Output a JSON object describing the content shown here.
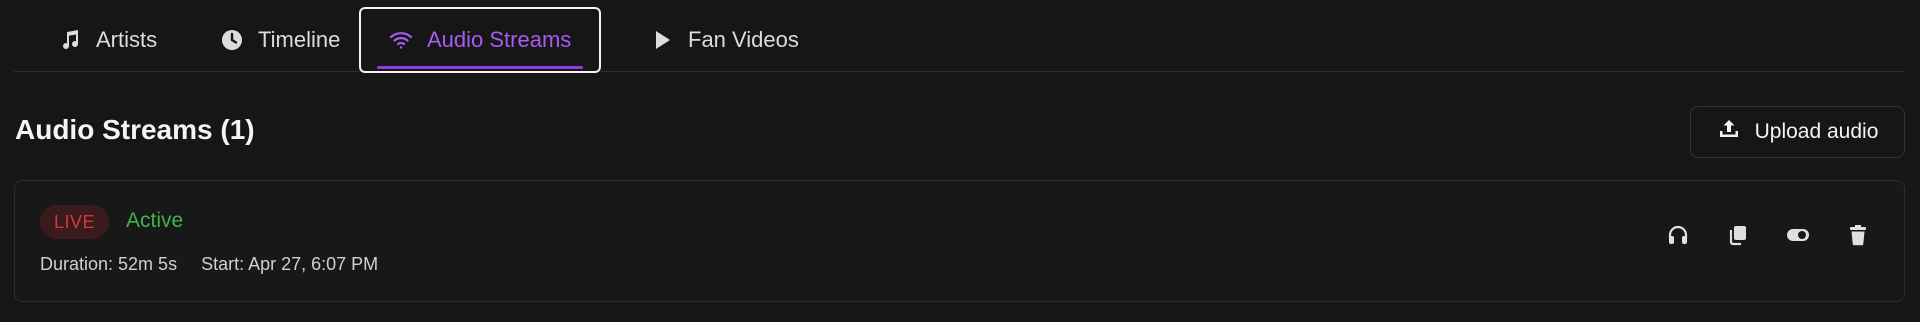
{
  "tabs": [
    {
      "label": "Artists",
      "icon": "music-note-icon",
      "active": false
    },
    {
      "label": "Timeline",
      "icon": "clock-icon",
      "active": false
    },
    {
      "label": "Audio Streams",
      "icon": "wifi-icon",
      "active": true
    },
    {
      "label": "Fan Videos",
      "icon": "play-icon",
      "active": false
    }
  ],
  "header": {
    "title": "Audio Streams (1)",
    "upload_label": "Upload audio",
    "upload_icon": "upload-icon"
  },
  "stream": {
    "badge": "LIVE",
    "status": "Active",
    "duration": "Duration: 52m 5s",
    "start": "Start: Apr 27, 6:07 PM",
    "actions": [
      "headphones-icon",
      "copy-icon",
      "toggle-icon",
      "trash-icon"
    ]
  },
  "colors": {
    "background": "#161616",
    "accent": "#a75bf0",
    "live_red": "#d2383f",
    "active_green": "#3fb24c"
  }
}
